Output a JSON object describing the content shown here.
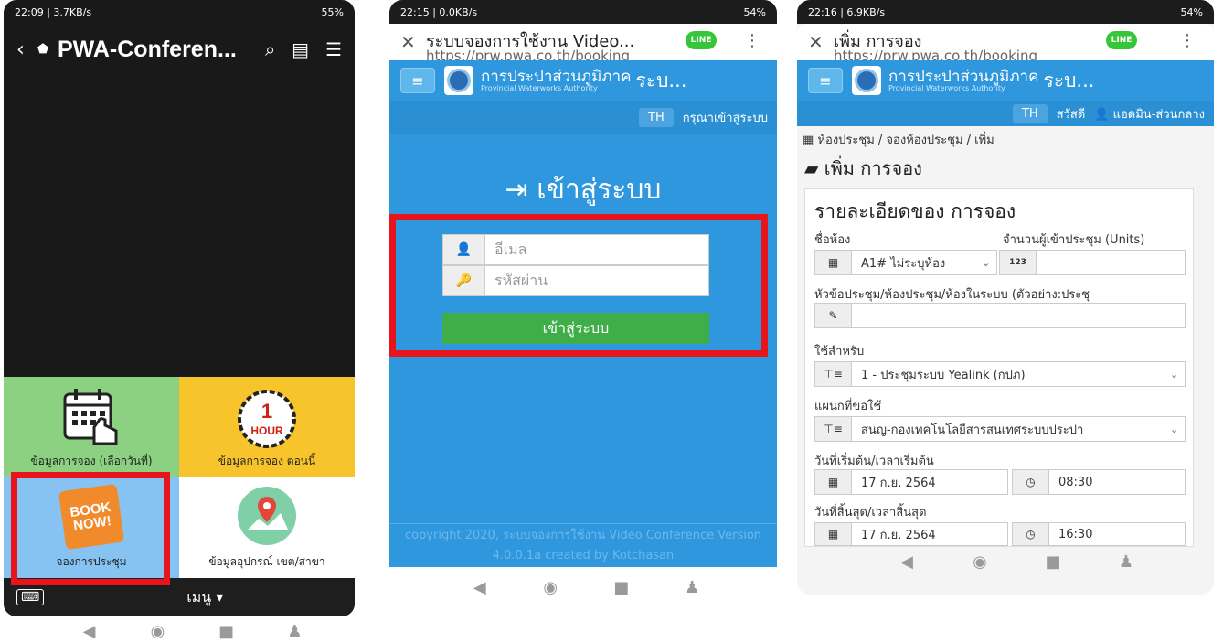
{
  "phone1": {
    "status": {
      "time": "22:09 | 3.7KB/s",
      "battery": "55%"
    },
    "title": "PWA-Conferen...",
    "tiles": [
      {
        "label": "ข้อมูลการจอง (เลือกวันที่)",
        "icon": "calendar-hand-icon",
        "color": "#8cd182"
      },
      {
        "label": "ข้อมูลการจอง ตอนนี้",
        "icon": "one-hour-clock-icon",
        "color": "#f7c42b"
      },
      {
        "label": "จองการประชุม",
        "icon": "book-now-icon",
        "color": "#86c3f2",
        "badge": "BOOK NOW!"
      },
      {
        "label": "ข้อมูลอุปกรณ์ เขต/สาขา",
        "icon": "map-pin-icon",
        "color": "#ffffff"
      }
    ],
    "menu_label": "เมนู",
    "hour_text": "1",
    "hour_word": "HOUR"
  },
  "phone2": {
    "status": {
      "time": "22:15 | 0.0KB/s",
      "battery": "54%"
    },
    "tab_title": "ระบบจองการใช้งาน Video...",
    "url": "https://prw.pwa.co.th/booking",
    "brand_th": "การประปาส่วนภูมิภาค",
    "brand_en": "Provincial Waterworks Authority",
    "brand_suffix": "ระบ...",
    "lang": "TH",
    "login_prompt": "กรุณาเข้าสู่ระบบ",
    "login_title": "เข้าสู่ระบบ",
    "email_placeholder": "อีเมล",
    "password_placeholder": "รหัสผ่าน",
    "submit_label": "เข้าสู่ระบบ",
    "footer": "copyright 2020, ระบบจองการใช้งาน Video Conference Version 4.0.0.1a created by Kotchasan"
  },
  "phone3": {
    "status": {
      "time": "22:16 | 6.9KB/s",
      "battery": "54%"
    },
    "tab_title": "เพิ่ม การจอง",
    "url": "https://prw.pwa.co.th/booking",
    "brand_th": "การประปาส่วนภูมิภาค",
    "brand_en": "Provincial Waterworks Authority",
    "brand_suffix": "ระบ...",
    "lang": "TH",
    "greeting": "สวัสดี",
    "user": "แอดมิน-ส่วนกลาง",
    "breadcrumb": "ห้องประชุม / จองห้องประชุม / เพิ่ม",
    "page_title": "เพิ่ม การจอง",
    "card_title": "รายละเอียดของ การจอง",
    "room_label": "ชื่อห้อง",
    "room_value": "A1# ไม่ระบุห้อง",
    "attendees_label": "จำนวนผู้เข้าประชุม (Units)",
    "topic_label": "หัวข้อประชุม/ห้องประชุม/ห้องในระบบ (ตัวอย่าง:ประชุ",
    "use_for_label": "ใช้สำหรับ",
    "use_for_value": "1 - ประชุมระบบ Yealink (กปภ)",
    "dept_label": "แผนกที่ขอใช้",
    "dept_value": "สนญ-กองเทคโนโลยีสารสนเทศระบบประปา",
    "start_label": "วันที่เริ่มต้น/เวลาเริ่มต้น",
    "start_date": "17 ก.ย. 2564",
    "start_time": "08:30",
    "end_label": "วันที่สิ้นสุด/เวลาสิ้นสุด",
    "end_date": "17 ก.ย. 2564",
    "end_time": "16:30"
  }
}
